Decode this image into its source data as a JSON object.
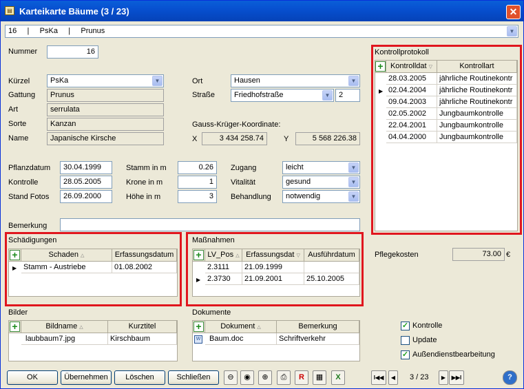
{
  "window": {
    "title": "Karteikarte Bäume  (3 / 23)",
    "close": "✕",
    "icon": "book-icon"
  },
  "record_combo": {
    "value": "16     |     PsKa     |     Prunus"
  },
  "nummer": {
    "label": "Nummer",
    "value": "16"
  },
  "kuerzel": {
    "label": "Kürzel",
    "value": "PsKa"
  },
  "gattung": {
    "label": "Gattung",
    "value": "Prunus"
  },
  "art": {
    "label": "Art",
    "value": "serrulata"
  },
  "sorte": {
    "label": "Sorte",
    "value": "Kanzan"
  },
  "name": {
    "label": "Name",
    "value": "Japanische Kirsche"
  },
  "ort": {
    "label": "Ort",
    "value": "Hausen"
  },
  "strasse": {
    "label": "Straße",
    "value": "Friedhofstraße",
    "hausnr": "2"
  },
  "gk": {
    "label": "Gauss-Krüger-Koordinate:",
    "x_label": "X",
    "x": "3 434 258.74",
    "y_label": "Y",
    "y": "5 568 226.38"
  },
  "pflanzdatum": {
    "label": "Pflanzdatum",
    "value": "30.04.1999"
  },
  "kontrolle": {
    "label": "Kontrolle",
    "value": "28.05.2005"
  },
  "stand_fotos": {
    "label": "Stand Fotos",
    "value": "26.09.2000"
  },
  "stamm": {
    "label": "Stamm in m",
    "value": "0.26"
  },
  "krone": {
    "label": "Krone  in m",
    "value": "1"
  },
  "hoehe": {
    "label": "Höhe  in m",
    "value": "3"
  },
  "zugang": {
    "label": "Zugang",
    "value": "leicht"
  },
  "vitalitaet": {
    "label": "Vitalität",
    "value": "gesund"
  },
  "behandlung": {
    "label": "Behandlung",
    "value": "notwendig"
  },
  "bemerkung": {
    "label": "Bemerkung",
    "value": ""
  },
  "kontrollprotokoll": {
    "title": "Kontrollprotokoll",
    "cols": [
      "Kontrolldat",
      "Kontrollart"
    ],
    "rows": [
      [
        "28.03.2005",
        "jährliche Routinekontr"
      ],
      [
        "02.04.2004",
        "jährliche Routinekontr"
      ],
      [
        "09.04.2003",
        "jährliche Routinekontr"
      ],
      [
        "02.05.2002",
        "Jungbaumkontrolle"
      ],
      [
        "22.04.2001",
        "Jungbaumkontrolle"
      ],
      [
        "04.04.2000",
        "Jungbaumkontrolle"
      ]
    ]
  },
  "schaedigungen": {
    "title": "Schädigungen",
    "cols": [
      "Schaden",
      "Erfassungsdatum"
    ],
    "rows": [
      [
        "Stamm - Austriebe",
        "01.08.2002"
      ]
    ]
  },
  "massnahmen": {
    "title": "Maßnahmen",
    "cols": [
      "LV_Pos",
      "Erfassungsdat",
      "Ausführdatum"
    ],
    "rows": [
      [
        "2.3111",
        "21.09.1999",
        ""
      ],
      [
        "2.3730",
        "21.09.2001",
        "25.10.2005"
      ]
    ]
  },
  "pflegekosten": {
    "label": "Pflegekosten",
    "value": "73.00",
    "unit": "€"
  },
  "bilder": {
    "title": "Bilder",
    "cols": [
      "Bildname",
      "Kurztitel"
    ],
    "rows": [
      [
        "laubbaum7.jpg",
        "Kirschbaum"
      ]
    ]
  },
  "dokumente": {
    "title": "Dokumente",
    "cols": [
      "Dokument",
      "Bemerkung"
    ],
    "rows": [
      [
        "Baum.doc",
        "Schriftverkehr"
      ]
    ]
  },
  "checks": [
    {
      "label": "Kontrolle",
      "checked": true
    },
    {
      "label": "Update",
      "checked": false
    },
    {
      "label": "Außendienstbearbeitung",
      "checked": true
    }
  ],
  "buttons": {
    "ok": "OK",
    "uebernehmen": "Übernehmen",
    "loeschen": "Löschen",
    "schliessen": "Schließen"
  },
  "nav": {
    "first": "I◀◀",
    "prev": "◀",
    "pos": "3 / 23",
    "next": "▶",
    "last": "▶▶I",
    "help": "?"
  }
}
